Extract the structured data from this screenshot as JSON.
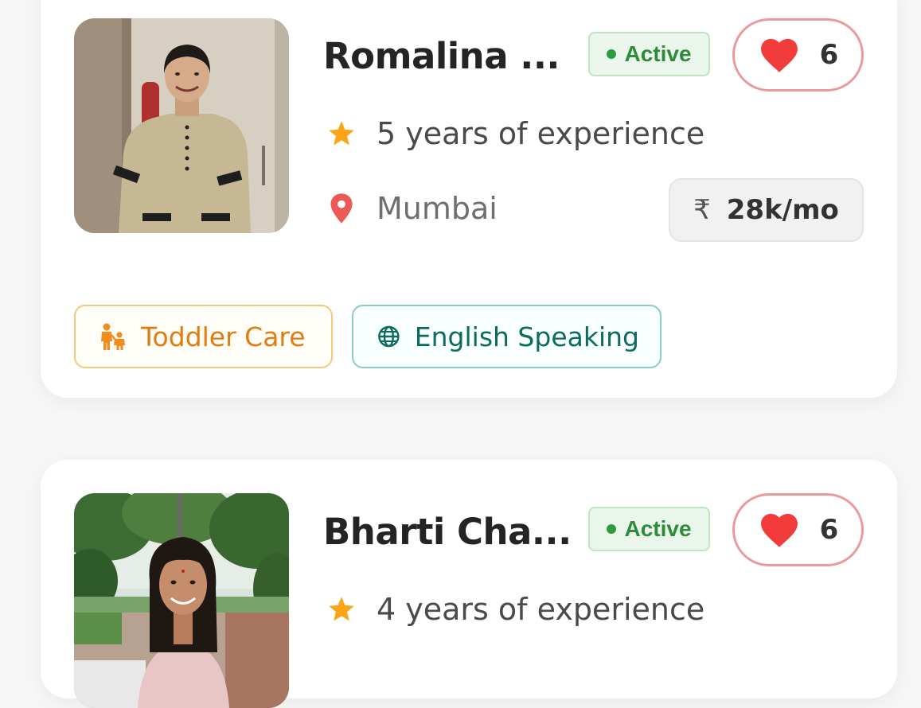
{
  "cards": [
    {
      "name": "Romalina ...",
      "status": "Active",
      "likes": "6",
      "experience": "5 years of experience",
      "location": "Mumbai",
      "currency_symbol": "₹",
      "salary": "28k/mo",
      "tags": [
        {
          "label": "Toddler Care",
          "icon": "toddler-care-icon"
        },
        {
          "label": "English Speaking",
          "icon": "globe-icon"
        }
      ]
    },
    {
      "name": "Bharti Cha...",
      "status": "Active",
      "likes": "6",
      "experience": "4 years of experience"
    }
  ],
  "colors": {
    "active_green": "#2e8b3a",
    "heart_red": "#f23b3b",
    "star_orange": "#fba417",
    "pin_red": "#ec5a58",
    "toddler_orange": "#e07c12",
    "english_teal": "#0b6b5e"
  }
}
